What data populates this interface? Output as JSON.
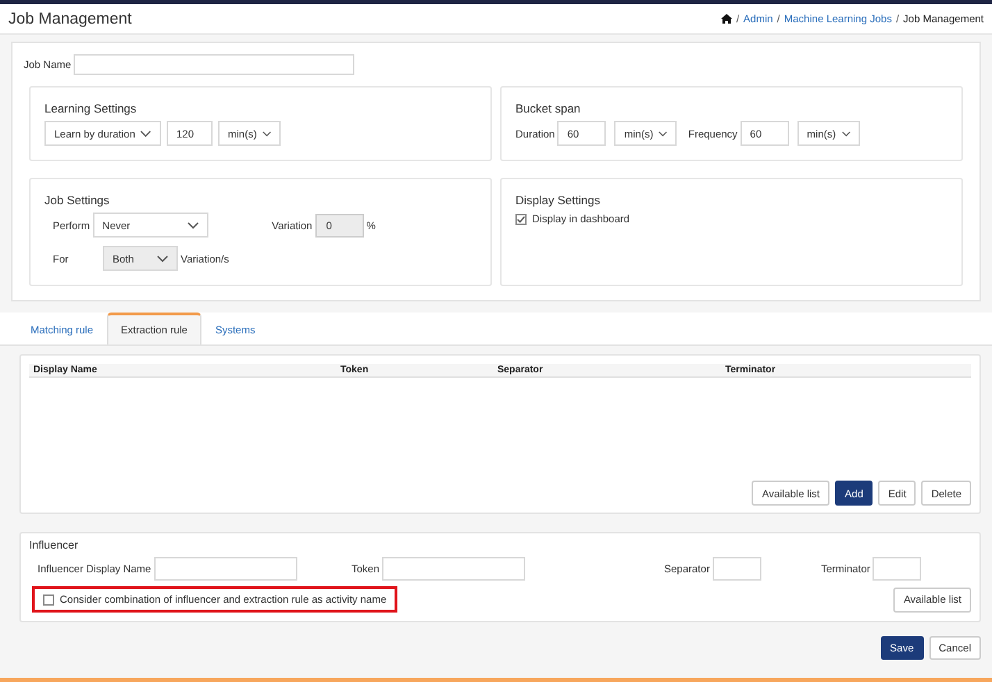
{
  "header": {
    "title": "Job Management",
    "separator": "/",
    "breadcrumb": [
      {
        "label": "Admin",
        "link": true
      },
      {
        "label": "Machine Learning Jobs",
        "link": true
      },
      {
        "label": "Job Management",
        "link": false
      }
    ]
  },
  "job_name": {
    "label": "Job Name"
  },
  "learning_settings": {
    "title": "Learning Settings",
    "mode": "Learn by duration",
    "amount": "120",
    "unit": "min(s)"
  },
  "bucket_span": {
    "title": "Bucket span",
    "duration_label": "Duration",
    "duration": "60",
    "duration_unit": "min(s)",
    "frequency_label": "Frequency",
    "frequency": "60",
    "frequency_unit": "min(s)"
  },
  "job_settings": {
    "title": "Job Settings",
    "perform_label": "Perform",
    "perform": "Never",
    "variation_label": "Variation",
    "variation": "0",
    "variation_disabled": true,
    "variation_suffix": "%",
    "for_label": "For",
    "for": "Both",
    "for_disabled": true,
    "for_suffix": "Variation/s"
  },
  "display_settings": {
    "title": "Display Settings",
    "checkbox": {
      "label": "Display in dashboard",
      "checked": true
    }
  },
  "tabs": [
    {
      "label": "Matching rule",
      "selected": false
    },
    {
      "label": "Extraction rule",
      "selected": true
    },
    {
      "label": "Systems",
      "selected": false
    }
  ],
  "extraction_table": {
    "columns": [
      "Display Name",
      "Token",
      "Separator",
      "Terminator"
    ],
    "buttons": [
      {
        "label": "Available list",
        "primary": false
      },
      {
        "label": "Add",
        "primary": true
      },
      {
        "label": "Edit",
        "primary": false
      },
      {
        "label": "Delete",
        "primary": false
      }
    ]
  },
  "influencer": {
    "title": "Influencer",
    "fields": [
      {
        "label": "Influencer Display Name",
        "kind": "wide"
      },
      {
        "label": "Token",
        "kind": "wide"
      },
      {
        "label": "Separator",
        "kind": "narrow"
      },
      {
        "label": "Terminator",
        "kind": "narrow"
      }
    ],
    "combination": {
      "label": "Consider combination of influencer and extraction rule as activity name",
      "checked": false,
      "highlighted": true
    },
    "button": "Available list"
  },
  "footer_buttons": [
    {
      "label": "Save",
      "primary": true
    },
    {
      "label": "Cancel",
      "primary": false
    }
  ]
}
